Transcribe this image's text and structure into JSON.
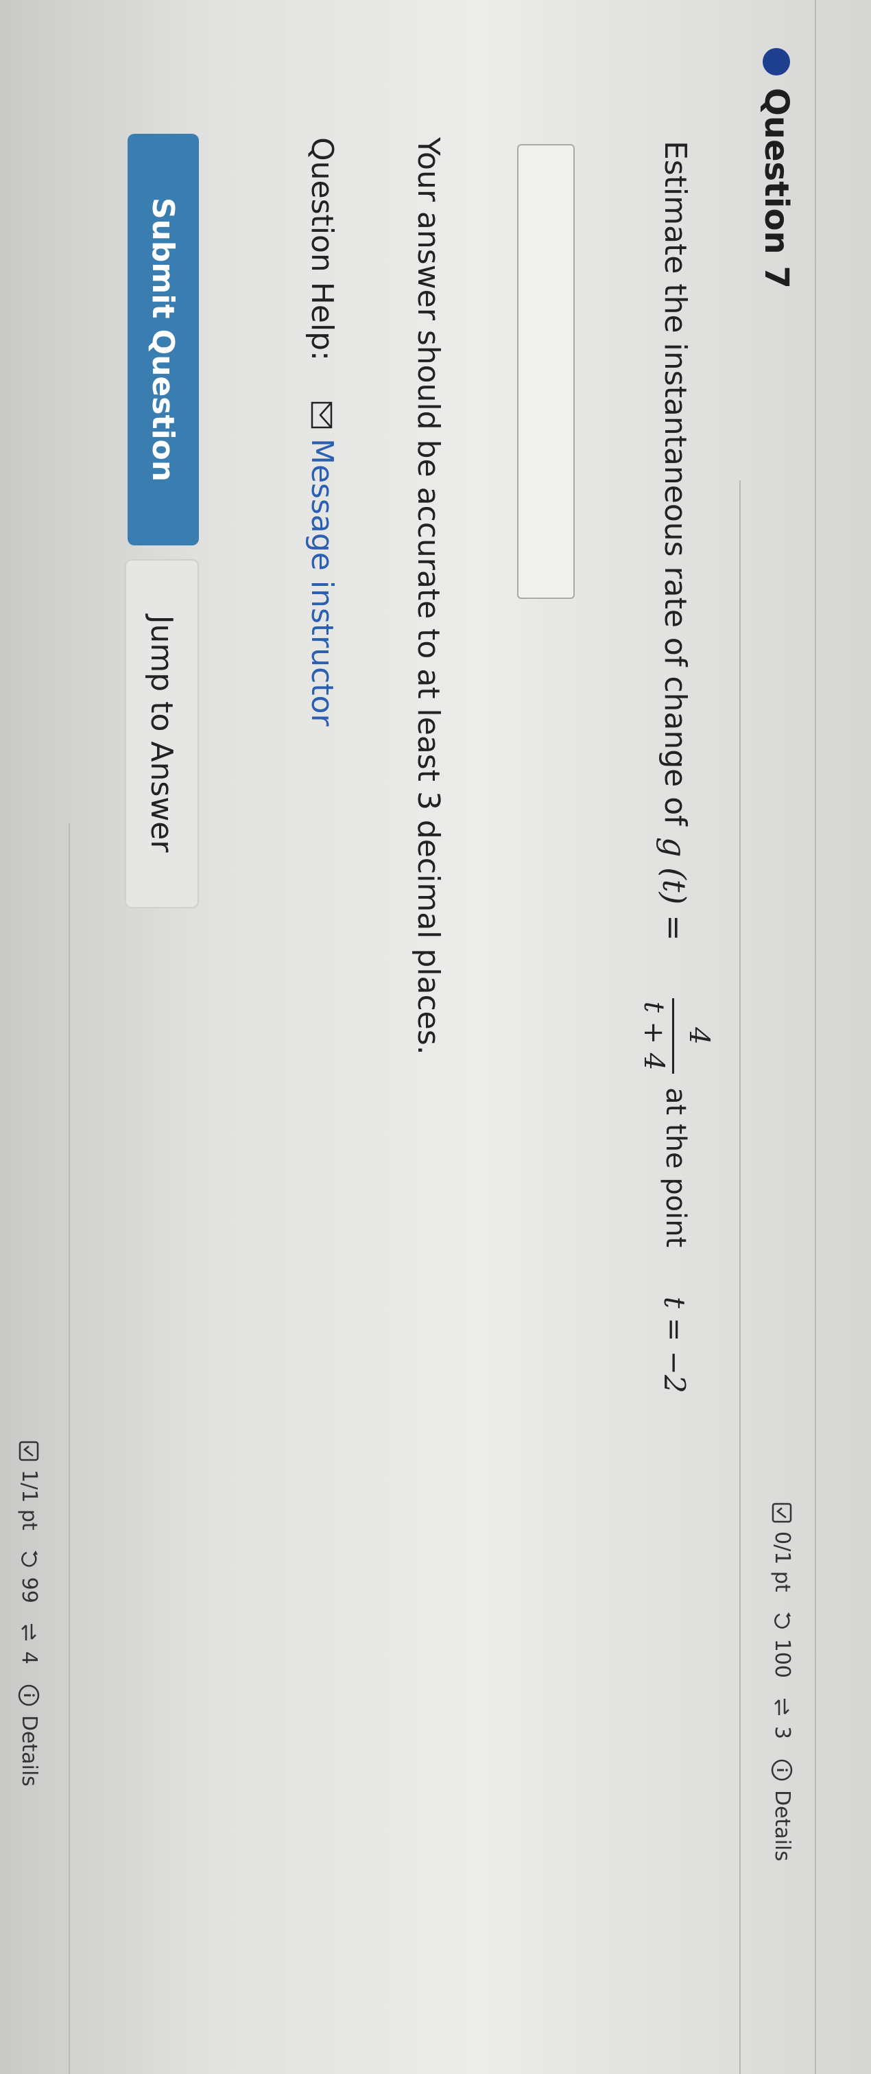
{
  "question": {
    "title": "Question 7",
    "score": "0/1 pt",
    "attempts": "100",
    "retries": "3",
    "details": "Details"
  },
  "prompt": {
    "prefix": "Estimate the instantaneous rate of change of",
    "function_name": "g (t) =",
    "numerator": "4",
    "denominator": "t + 4",
    "suffix": "at the point",
    "point": "t = −2"
  },
  "answer": {
    "value": ""
  },
  "instruction": "Your answer should be accurate to at least 3 decimal places.",
  "help": {
    "label": "Question Help:",
    "link": "Message instructor"
  },
  "buttons": {
    "submit": "Submit Question",
    "jump": "Jump to Answer"
  },
  "next_question": {
    "score": "1/1 pt",
    "attempts": "99",
    "retries": "4",
    "details": "Details"
  }
}
